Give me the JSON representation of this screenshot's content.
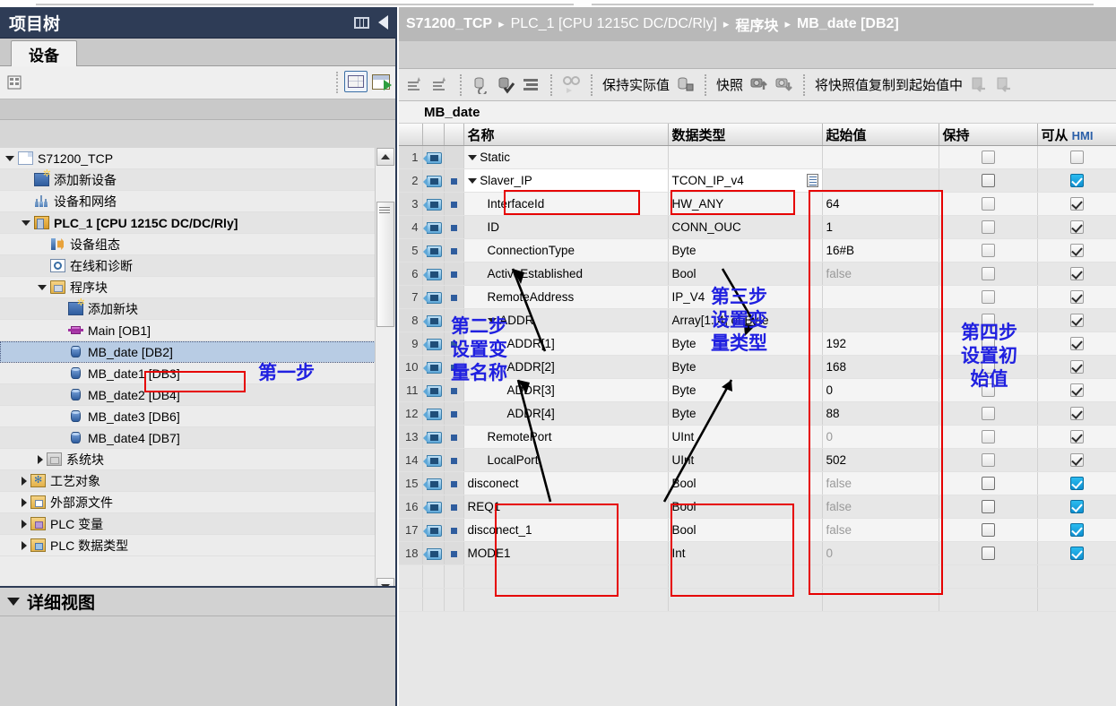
{
  "left_panel": {
    "title": "项目树",
    "tab_label": "设备",
    "detail_view_label": "详细视图",
    "tree": [
      {
        "label": "S71200_TCP",
        "icon": "document-icon",
        "depth": 0,
        "expander": "down"
      },
      {
        "label": "添加新设备",
        "icon": "add-new-device-icon",
        "depth": 1,
        "expander": "none"
      },
      {
        "label": "设备和网络",
        "icon": "devices-networks-icon",
        "depth": 1,
        "expander": "none"
      },
      {
        "label": "PLC_1 [CPU 1215C DC/DC/Rly]",
        "icon": "plc-icon",
        "depth": 1,
        "expander": "down",
        "bold": true
      },
      {
        "label": "设备组态",
        "icon": "device-configuration-icon",
        "depth": 2,
        "expander": "none"
      },
      {
        "label": "在线和诊断",
        "icon": "online-diagnostics-icon",
        "depth": 2,
        "expander": "none"
      },
      {
        "label": "程序块",
        "icon": "program-blocks-folder-icon",
        "depth": 2,
        "expander": "down"
      },
      {
        "label": "添加新块",
        "icon": "add-new-block-icon",
        "depth": 3,
        "expander": "none"
      },
      {
        "label": "Main [OB1]",
        "icon": "ob-block-icon",
        "depth": 3,
        "expander": "none"
      },
      {
        "label": "MB_date [DB2]",
        "icon": "db-block-icon",
        "depth": 3,
        "expander": "none",
        "selected": true
      },
      {
        "label": "MB_date1 [DB3]",
        "icon": "db-block-icon",
        "depth": 3,
        "expander": "none"
      },
      {
        "label": "MB_date2 [DB4]",
        "icon": "db-block-icon",
        "depth": 3,
        "expander": "none"
      },
      {
        "label": "MB_date3 [DB6]",
        "icon": "db-block-icon",
        "depth": 3,
        "expander": "none"
      },
      {
        "label": "MB_date4 [DB7]",
        "icon": "db-block-icon",
        "depth": 3,
        "expander": "none"
      },
      {
        "label": "系统块",
        "icon": "system-blocks-folder-icon",
        "depth": 2,
        "expander": "right"
      },
      {
        "label": "工艺对象",
        "icon": "technology-objects-icon",
        "depth": 1,
        "expander": "right"
      },
      {
        "label": "外部源文件",
        "icon": "external-source-files-icon",
        "depth": 1,
        "expander": "right"
      },
      {
        "label": "PLC 变量",
        "icon": "plc-tags-icon",
        "depth": 1,
        "expander": "right"
      },
      {
        "label": "PLC 数据类型",
        "icon": "plc-data-types-icon",
        "depth": 1,
        "expander": "right"
      }
    ]
  },
  "breadcrumb": {
    "items": [
      "S71200_TCP",
      "PLC_1 [CPU 1215C DC/DC/Rly]",
      "程序块",
      "MB_date [DB2]"
    ],
    "separator": "▸"
  },
  "editor_toolbar": {
    "icons_left": [
      "insert-row-icon",
      "insert-row-below-icon",
      "snapshot-monitor-icon",
      "monitor-check-icon",
      "list-icon",
      "monitor-glasses-icon"
    ],
    "retain_actual_label": "保持实际值",
    "retain_icon": "retain-lock-icon",
    "snapshot_label": "快照",
    "snapshot_icons": [
      "snapshot-up-icon",
      "snapshot-down-icon"
    ],
    "copy_snapshot_label": "将快照值复制到起始值中",
    "load_icons": [
      "load-start-values-icon",
      "load-start-values-2-icon"
    ]
  },
  "block_name": "MB_date",
  "table": {
    "headers": [
      "",
      "",
      "",
      "名称",
      "数据类型",
      "起始值",
      "保持",
      "可从 HMI"
    ],
    "header_hmi_prefix": "可从 ",
    "header_hmi_suffix": "HMI",
    "rows": [
      {
        "n": "1",
        "tag": true,
        "bullet": "",
        "expander": "down",
        "indent": 0,
        "name": "Static",
        "dtype": "",
        "start": "",
        "start_gray": false,
        "retain": "empty",
        "hmi": "empty"
      },
      {
        "n": "2",
        "tag": true,
        "bullet": "sq",
        "expander": "down",
        "indent": 0,
        "name": "Slaver_IP",
        "dtype": "TCON_IP_v4",
        "start": "",
        "start_gray": false,
        "retain": "empty-dark",
        "hmi": "checked-blue",
        "editing": true
      },
      {
        "n": "3",
        "tag": true,
        "bullet": "sq",
        "expander": "none",
        "indent": 1,
        "name": "InterfaceId",
        "dtype": "HW_ANY",
        "start": "64",
        "start_gray": false,
        "retain": "empty",
        "hmi": "checked"
      },
      {
        "n": "4",
        "tag": true,
        "bullet": "sq",
        "expander": "none",
        "indent": 1,
        "name": "ID",
        "dtype": "CONN_OUC",
        "start": "1",
        "start_gray": false,
        "retain": "empty",
        "hmi": "checked"
      },
      {
        "n": "5",
        "tag": true,
        "bullet": "sq",
        "expander": "none",
        "indent": 1,
        "name": "ConnectionType",
        "dtype": "Byte",
        "start": "16#B",
        "start_gray": false,
        "retain": "empty",
        "hmi": "checked"
      },
      {
        "n": "6",
        "tag": true,
        "bullet": "sq",
        "expander": "none",
        "indent": 1,
        "name": "ActiveEstablished",
        "dtype": "Bool",
        "start": "false",
        "start_gray": true,
        "retain": "empty",
        "hmi": "checked"
      },
      {
        "n": "7",
        "tag": true,
        "bullet": "sq",
        "expander": "none",
        "indent": 1,
        "name": "RemoteAddress",
        "dtype": "IP_V4",
        "start": "",
        "start_gray": false,
        "retain": "empty",
        "hmi": "checked"
      },
      {
        "n": "8",
        "tag": true,
        "bullet": "",
        "expander": "down",
        "indent": 1,
        "name": "ADDR",
        "dtype": "Array[1..4] of Byte",
        "start": "",
        "start_gray": false,
        "retain": "empty",
        "hmi": "checked"
      },
      {
        "n": "9",
        "tag": true,
        "bullet": "sq",
        "expander": "none",
        "indent": 2,
        "name": "ADDR[1]",
        "dtype": "Byte",
        "start": "192",
        "start_gray": false,
        "retain": "empty",
        "hmi": "checked"
      },
      {
        "n": "10",
        "tag": true,
        "bullet": "sq",
        "expander": "none",
        "indent": 2,
        "name": "ADDR[2]",
        "dtype": "Byte",
        "start": "168",
        "start_gray": false,
        "retain": "empty",
        "hmi": "checked"
      },
      {
        "n": "11",
        "tag": true,
        "bullet": "sq",
        "expander": "none",
        "indent": 2,
        "name": "ADDR[3]",
        "dtype": "Byte",
        "start": "0",
        "start_gray": false,
        "retain": "empty",
        "hmi": "checked"
      },
      {
        "n": "12",
        "tag": true,
        "bullet": "sq",
        "expander": "none",
        "indent": 2,
        "name": "ADDR[4]",
        "dtype": "Byte",
        "start": "88",
        "start_gray": false,
        "retain": "empty",
        "hmi": "checked"
      },
      {
        "n": "13",
        "tag": true,
        "bullet": "sq",
        "expander": "none",
        "indent": 1,
        "name": "RemotePort",
        "dtype": "UInt",
        "start": "0",
        "start_gray": true,
        "retain": "empty",
        "hmi": "checked"
      },
      {
        "n": "14",
        "tag": true,
        "bullet": "sq",
        "expander": "none",
        "indent": 1,
        "name": "LocalPort",
        "dtype": "UInt",
        "start": "502",
        "start_gray": false,
        "retain": "empty",
        "hmi": "checked"
      },
      {
        "n": "15",
        "tag": true,
        "bullet": "sq",
        "expander": "none",
        "indent": 0,
        "name": "disconect",
        "dtype": "Bool",
        "start": "false",
        "start_gray": true,
        "retain": "empty-dark",
        "hmi": "checked-blue"
      },
      {
        "n": "16",
        "tag": true,
        "bullet": "sq",
        "expander": "none",
        "indent": 0,
        "name": "REQ1",
        "dtype": "Bool",
        "start": "false",
        "start_gray": true,
        "retain": "empty-dark",
        "hmi": "checked-blue"
      },
      {
        "n": "17",
        "tag": true,
        "bullet": "sq",
        "expander": "none",
        "indent": 0,
        "name": "disconect_1",
        "dtype": "Bool",
        "start": "false",
        "start_gray": true,
        "retain": "empty-dark",
        "hmi": "checked-blue"
      },
      {
        "n": "18",
        "tag": true,
        "bullet": "sq",
        "expander": "none",
        "indent": 0,
        "name": "MODE1",
        "dtype": "Int",
        "start": "0",
        "start_gray": true,
        "retain": "empty-dark",
        "hmi": "checked-blue"
      }
    ]
  },
  "annotations": {
    "color_box": "#e60000",
    "color_text": "#2020e0",
    "step1": "第一步",
    "step2": "第二步\n设置变\n量名称",
    "step3": "第三步\n设置变\n量类型",
    "step4": "第四步\n设置初\n始值"
  }
}
